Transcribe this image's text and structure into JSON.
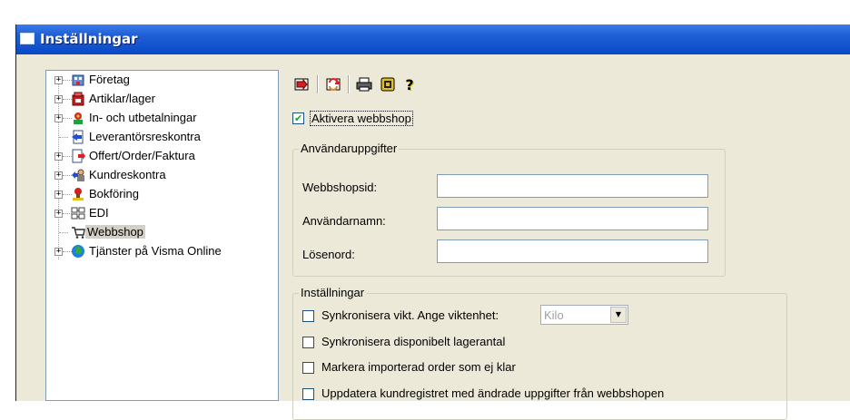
{
  "window": {
    "title": "Inställningar"
  },
  "tree": {
    "items": [
      {
        "label": "Företag",
        "expander": "+",
        "icon": "company-icon"
      },
      {
        "label": "Artiklar/lager",
        "expander": "+",
        "icon": "articles-icon"
      },
      {
        "label": "In- och utbetalningar",
        "expander": "+",
        "icon": "payments-icon"
      },
      {
        "label": "Leverantörsreskontra",
        "expander": "",
        "icon": "supplier-ledger-icon"
      },
      {
        "label": "Offert/Order/Faktura",
        "expander": "+",
        "icon": "invoice-icon"
      },
      {
        "label": "Kundreskontra",
        "expander": "+",
        "icon": "customer-ledger-icon"
      },
      {
        "label": "Bokföring",
        "expander": "+",
        "icon": "accounting-icon"
      },
      {
        "label": "EDI",
        "expander": "+",
        "icon": "edi-icon"
      },
      {
        "label": "Webbshop",
        "expander": "",
        "icon": "cart-icon",
        "selected": true
      },
      {
        "label": "Tjänster på Visma Online",
        "expander": "+",
        "icon": "globe-icon"
      }
    ]
  },
  "toolbar": {
    "buttons": [
      {
        "icon": "import-icon"
      },
      {
        "icon": "sync-icon"
      },
      {
        "icon": "print-icon"
      },
      {
        "icon": "info-icon"
      },
      {
        "icon": "help-icon",
        "glyph": "?"
      }
    ]
  },
  "activate": {
    "label": "Aktivera webbshop",
    "checked": true
  },
  "credentials": {
    "title": "Användaruppgifter",
    "shop_id_label": "Webbshopsid:",
    "shop_id_value": "",
    "username_label": "Användarnamn:",
    "username_value": "",
    "password_label": "Lösenord:",
    "password_value": ""
  },
  "settings": {
    "title": "Inställningar",
    "sync_weight_label": "Synkronisera vikt. Ange viktenhet:",
    "weight_unit": "Kilo",
    "sync_stock_label": "Synkronisera disponibelt lagerantal",
    "mark_order_label": "Markera importerad order som ej klar",
    "update_customers_label": "Uppdatera kundregistret med ändrade uppgifter från webbshopen"
  },
  "colors": {
    "titlebar": "#0a49c5",
    "check": "#21a121",
    "input_border": "#7f9db9"
  }
}
